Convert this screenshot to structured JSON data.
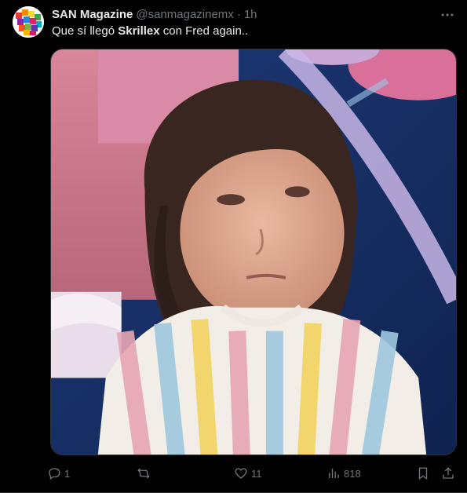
{
  "tweet": {
    "author_name": "SAN Magazine",
    "author_handle": "@sanmagazinemx",
    "separator": "·",
    "time": "1h",
    "text_before": "Que sí llegó ",
    "text_bold": "Skrillex",
    "text_after": " con Fred again..",
    "media_description": "photo",
    "stats": {
      "replies": "1",
      "reposts": "",
      "likes": "11",
      "views": "818"
    }
  },
  "icons": {
    "more": "more-horizontal-icon",
    "reply": "reply-icon",
    "repost": "repost-icon",
    "like": "heart-icon",
    "views": "views-chart-icon",
    "bookmark": "bookmark-icon",
    "share": "share-icon"
  },
  "colors": {
    "background": "#000000",
    "text_primary": "#e7e9ea",
    "text_secondary": "#71767b",
    "border": "#2f3336"
  }
}
